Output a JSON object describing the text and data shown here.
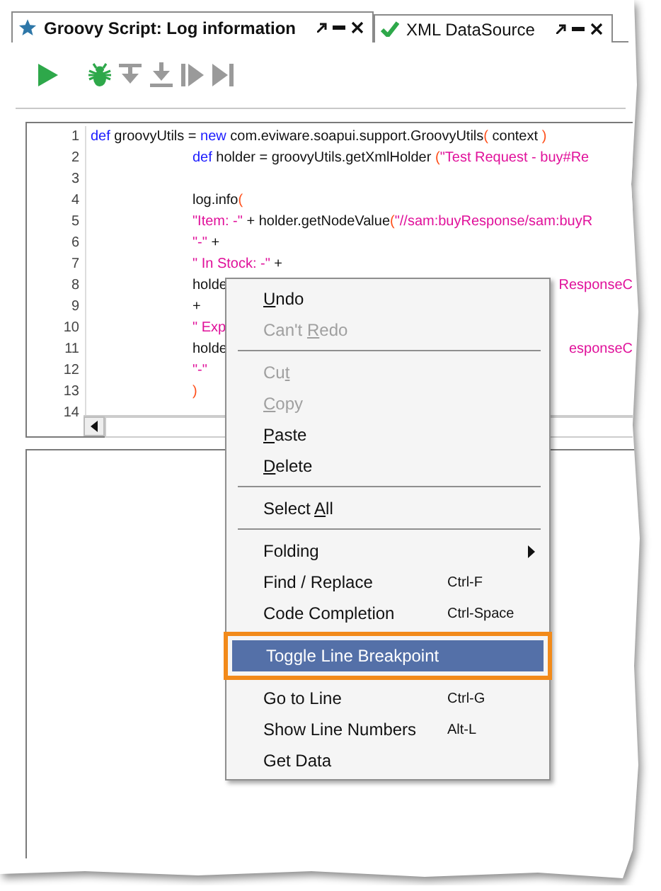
{
  "tabs": [
    {
      "label": "Groovy Script: Log information",
      "selected": true
    },
    {
      "label": "XML DataSource",
      "selected": false
    }
  ],
  "toolbar": {
    "buttons": [
      {
        "kind": "run",
        "disabled": false
      },
      {
        "kind": "debug",
        "disabled": false
      },
      {
        "kind": "step-over",
        "disabled": true
      },
      {
        "kind": "step-into",
        "disabled": true
      },
      {
        "kind": "resume",
        "disabled": true
      },
      {
        "kind": "run-to-end",
        "disabled": true
      }
    ]
  },
  "code": {
    "lines": [
      {
        "number": "1",
        "indented": false,
        "segments": [
          {
            "kind": "keyword",
            "text": "def"
          },
          {
            "kind": "plain",
            "text": " groovyUtils = "
          },
          {
            "kind": "keyword",
            "text": "new"
          },
          {
            "kind": "plain",
            "text": " com.eviware.soapui.support.GroovyUtils"
          },
          {
            "kind": "paren",
            "text": "("
          },
          {
            "kind": "plain",
            "text": " context "
          },
          {
            "kind": "paren",
            "text": ")"
          }
        ]
      },
      {
        "number": "2",
        "indented": true,
        "segments": [
          {
            "kind": "keyword",
            "text": "def"
          },
          {
            "kind": "plain",
            "text": " holder = groovyUtils.getXmlHolder "
          },
          {
            "kind": "paren",
            "text": "("
          },
          {
            "kind": "string",
            "text": "\"Test Request - buy#Re"
          }
        ]
      },
      {
        "number": "3"
      },
      {
        "number": "4",
        "indented": true,
        "segments": [
          {
            "kind": "plain",
            "text": "log.info"
          },
          {
            "kind": "paren",
            "text": "("
          }
        ]
      },
      {
        "number": "5",
        "indented": true,
        "segments": [
          {
            "kind": "string",
            "text": "\"Item: -\""
          },
          {
            "kind": "plain",
            "text": " + holder.getNodeValue"
          },
          {
            "kind": "paren",
            "text": "("
          },
          {
            "kind": "string",
            "text": "\"//sam:buyResponse/sam:buyR"
          }
        ]
      },
      {
        "number": "6",
        "indented": true,
        "segments": [
          {
            "kind": "string",
            "text": "\"-\""
          },
          {
            "kind": "plain",
            "text": " +"
          }
        ]
      },
      {
        "number": "7",
        "indented": true,
        "segments": [
          {
            "kind": "string",
            "text": "\" In Stock: -\""
          },
          {
            "kind": "plain",
            "text": " +"
          }
        ]
      },
      {
        "number": "8",
        "indented": true,
        "segments": [
          {
            "kind": "plain",
            "text": "holde"
          }
        ],
        "tail": [
          {
            "kind": "string",
            "text": "ResponseC"
          }
        ]
      },
      {
        "number": "9",
        "indented": true,
        "segments": [
          {
            "kind": "plain",
            "text": "+"
          }
        ]
      },
      {
        "number": "10",
        "indented": true,
        "segments": [
          {
            "kind": "string",
            "text": "\" Exp"
          }
        ]
      },
      {
        "number": "11",
        "indented": true,
        "segments": [
          {
            "kind": "plain",
            "text": "holde"
          }
        ],
        "tail": [
          {
            "kind": "string",
            "text": "esponseC"
          }
        ]
      },
      {
        "number": "12",
        "indented": true,
        "segments": [
          {
            "kind": "string",
            "text": "\"-\""
          }
        ]
      },
      {
        "number": "13",
        "indented": true,
        "segments": [
          {
            "kind": "paren",
            "text": ")"
          }
        ]
      },
      {
        "number": "14"
      }
    ]
  },
  "menu": {
    "items": [
      {
        "kind": "item",
        "key": "U",
        "post": "ndo",
        "disabled": false,
        "selected": false
      },
      {
        "kind": "item",
        "pre": "Can't ",
        "key": "R",
        "post": "edo",
        "disabled": true,
        "selected": false
      },
      {
        "kind": "separator"
      },
      {
        "kind": "item",
        "pre": "Cu",
        "key": "t",
        "disabled": true,
        "selected": false
      },
      {
        "kind": "item",
        "key": "C",
        "post": "opy",
        "disabled": true,
        "selected": false
      },
      {
        "kind": "item",
        "key": "P",
        "post": "aste",
        "disabled": false,
        "selected": false
      },
      {
        "kind": "item",
        "key": "D",
        "post": "elete",
        "disabled": false,
        "selected": false
      },
      {
        "kind": "separator"
      },
      {
        "kind": "item",
        "pre": "Select ",
        "key": "A",
        "post": "ll",
        "disabled": false,
        "selected": false
      },
      {
        "kind": "separator"
      },
      {
        "kind": "submenu",
        "pre": "Folding",
        "disabled": false,
        "selected": false
      },
      {
        "kind": "item",
        "pre": "Find / Replace",
        "shortcut": "Ctrl-F",
        "disabled": false,
        "selected": false
      },
      {
        "kind": "item",
        "pre": "Code Completion",
        "shortcut": "Ctrl-Space",
        "disabled": false,
        "selected": false
      },
      {
        "kind": "separator"
      },
      {
        "kind": "item",
        "pre": "Toggle Line Breakpoint",
        "disabled": false,
        "selected": true
      },
      {
        "kind": "separator"
      },
      {
        "kind": "item",
        "pre": "Go to Line",
        "shortcut": "Ctrl-G",
        "disabled": false,
        "selected": false
      },
      {
        "kind": "item",
        "pre": "Show Line Numbers",
        "shortcut": "Alt-L",
        "disabled": false,
        "selected": false
      },
      {
        "kind": "item",
        "pre": "Get Data",
        "disabled": false,
        "selected": false
      }
    ]
  }
}
